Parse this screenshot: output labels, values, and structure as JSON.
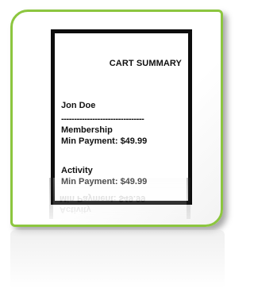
{
  "cart": {
    "title": "CART SUMMARY",
    "customer_name": "Jon Doe",
    "divider": "--------------------------------",
    "items": [
      {
        "name": "Membership",
        "min_payment": "Min Payment: $49.99"
      },
      {
        "name": "Activity",
        "min_payment": "Min Payment: $49.99"
      }
    ]
  },
  "colors": {
    "card_border": "#8cc63f",
    "receipt_border": "#0d0d0d"
  }
}
